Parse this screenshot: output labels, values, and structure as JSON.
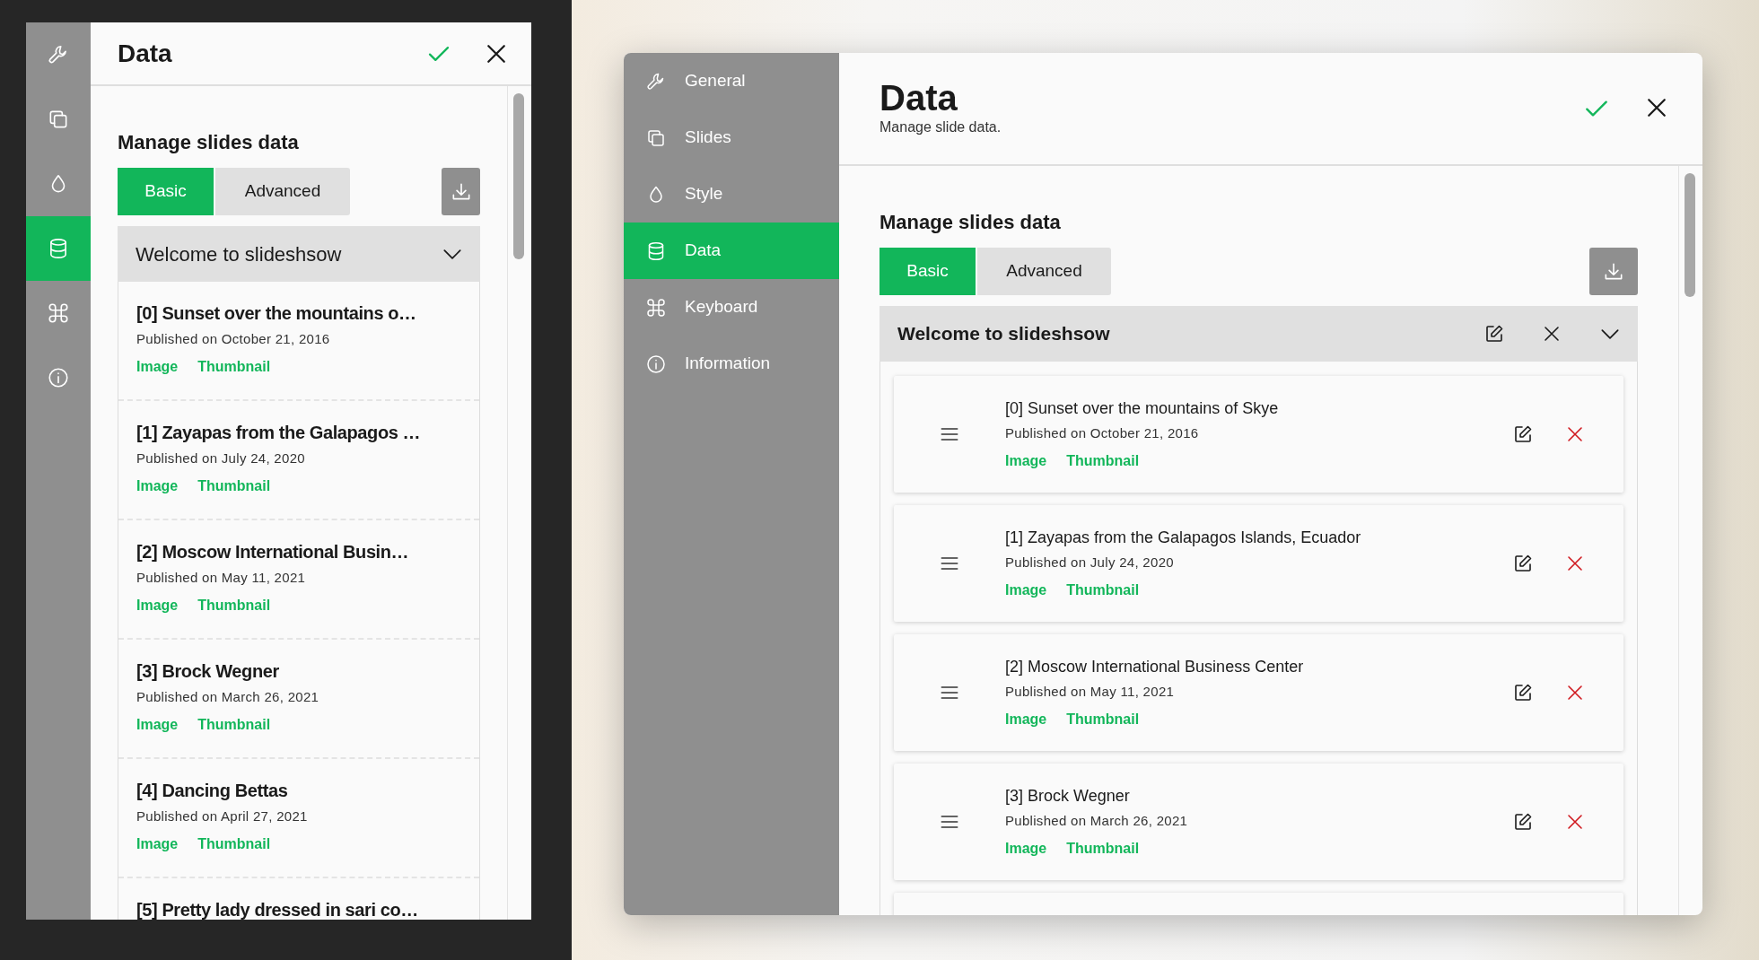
{
  "panels": [
    {
      "kind": "compact",
      "title": "Data",
      "nav": [
        {
          "selected": false
        },
        {
          "selected": false
        },
        {
          "selected": false
        },
        {
          "selected": true
        },
        {
          "selected": false
        },
        {
          "selected": false
        }
      ],
      "section_title": "Manage slides data",
      "tabs": [
        {
          "label": "Basic",
          "selected": true
        },
        {
          "label": "Advanced",
          "selected": false
        }
      ],
      "group": {
        "title": "Welcome to slideshsow"
      },
      "slides": [
        {
          "title": "[0] Sunset over the mountains o…",
          "published": "Published on October 21, 2016",
          "links": [
            "Image",
            "Thumbnail"
          ]
        },
        {
          "title": "[1] Zayapas from the Galapagos …",
          "published": "Published on July 24, 2020",
          "links": [
            "Image",
            "Thumbnail"
          ]
        },
        {
          "title": "[2] Moscow International Busin…",
          "published": "Published on May 11, 2021",
          "links": [
            "Image",
            "Thumbnail"
          ]
        },
        {
          "title": "[3] Brock Wegner",
          "published": "Published on March 26, 2021",
          "links": [
            "Image",
            "Thumbnail"
          ]
        },
        {
          "title": "[4] Dancing Bettas",
          "published": "Published on April 27, 2021",
          "links": [
            "Image",
            "Thumbnail"
          ]
        },
        {
          "title": "[5] Pretty lady dressed in sari co…"
        }
      ]
    },
    {
      "kind": "full",
      "title": "Data",
      "subtitle": "Manage slide data.",
      "nav": [
        {
          "label": "General",
          "selected": false
        },
        {
          "label": "Slides",
          "selected": false
        },
        {
          "label": "Style",
          "selected": false
        },
        {
          "label": "Data",
          "selected": true
        },
        {
          "label": "Keyboard",
          "selected": false
        },
        {
          "label": "Information",
          "selected": false
        }
      ],
      "section_title": "Manage slides data",
      "tabs": [
        {
          "label": "Basic",
          "selected": true
        },
        {
          "label": "Advanced",
          "selected": false
        }
      ],
      "group": {
        "title": "Welcome to slideshsow"
      },
      "more_below": true,
      "slides": [
        {
          "title": "[0] Sunset over the mountains of Skye",
          "published": "Published on October 21, 2016",
          "links": [
            "Image",
            "Thumbnail"
          ]
        },
        {
          "title": "[1] Zayapas from the Galapagos Islands, Ecuador",
          "published": "Published on July 24, 2020",
          "links": [
            "Image",
            "Thumbnail"
          ]
        },
        {
          "title": "[2] Moscow International Business Center",
          "published": "Published on May 11, 2021",
          "links": [
            "Image",
            "Thumbnail"
          ]
        },
        {
          "title": "[3] Brock Wegner",
          "published": "Published on March 26, 2021",
          "links": [
            "Image",
            "Thumbnail"
          ]
        }
      ]
    }
  ]
}
